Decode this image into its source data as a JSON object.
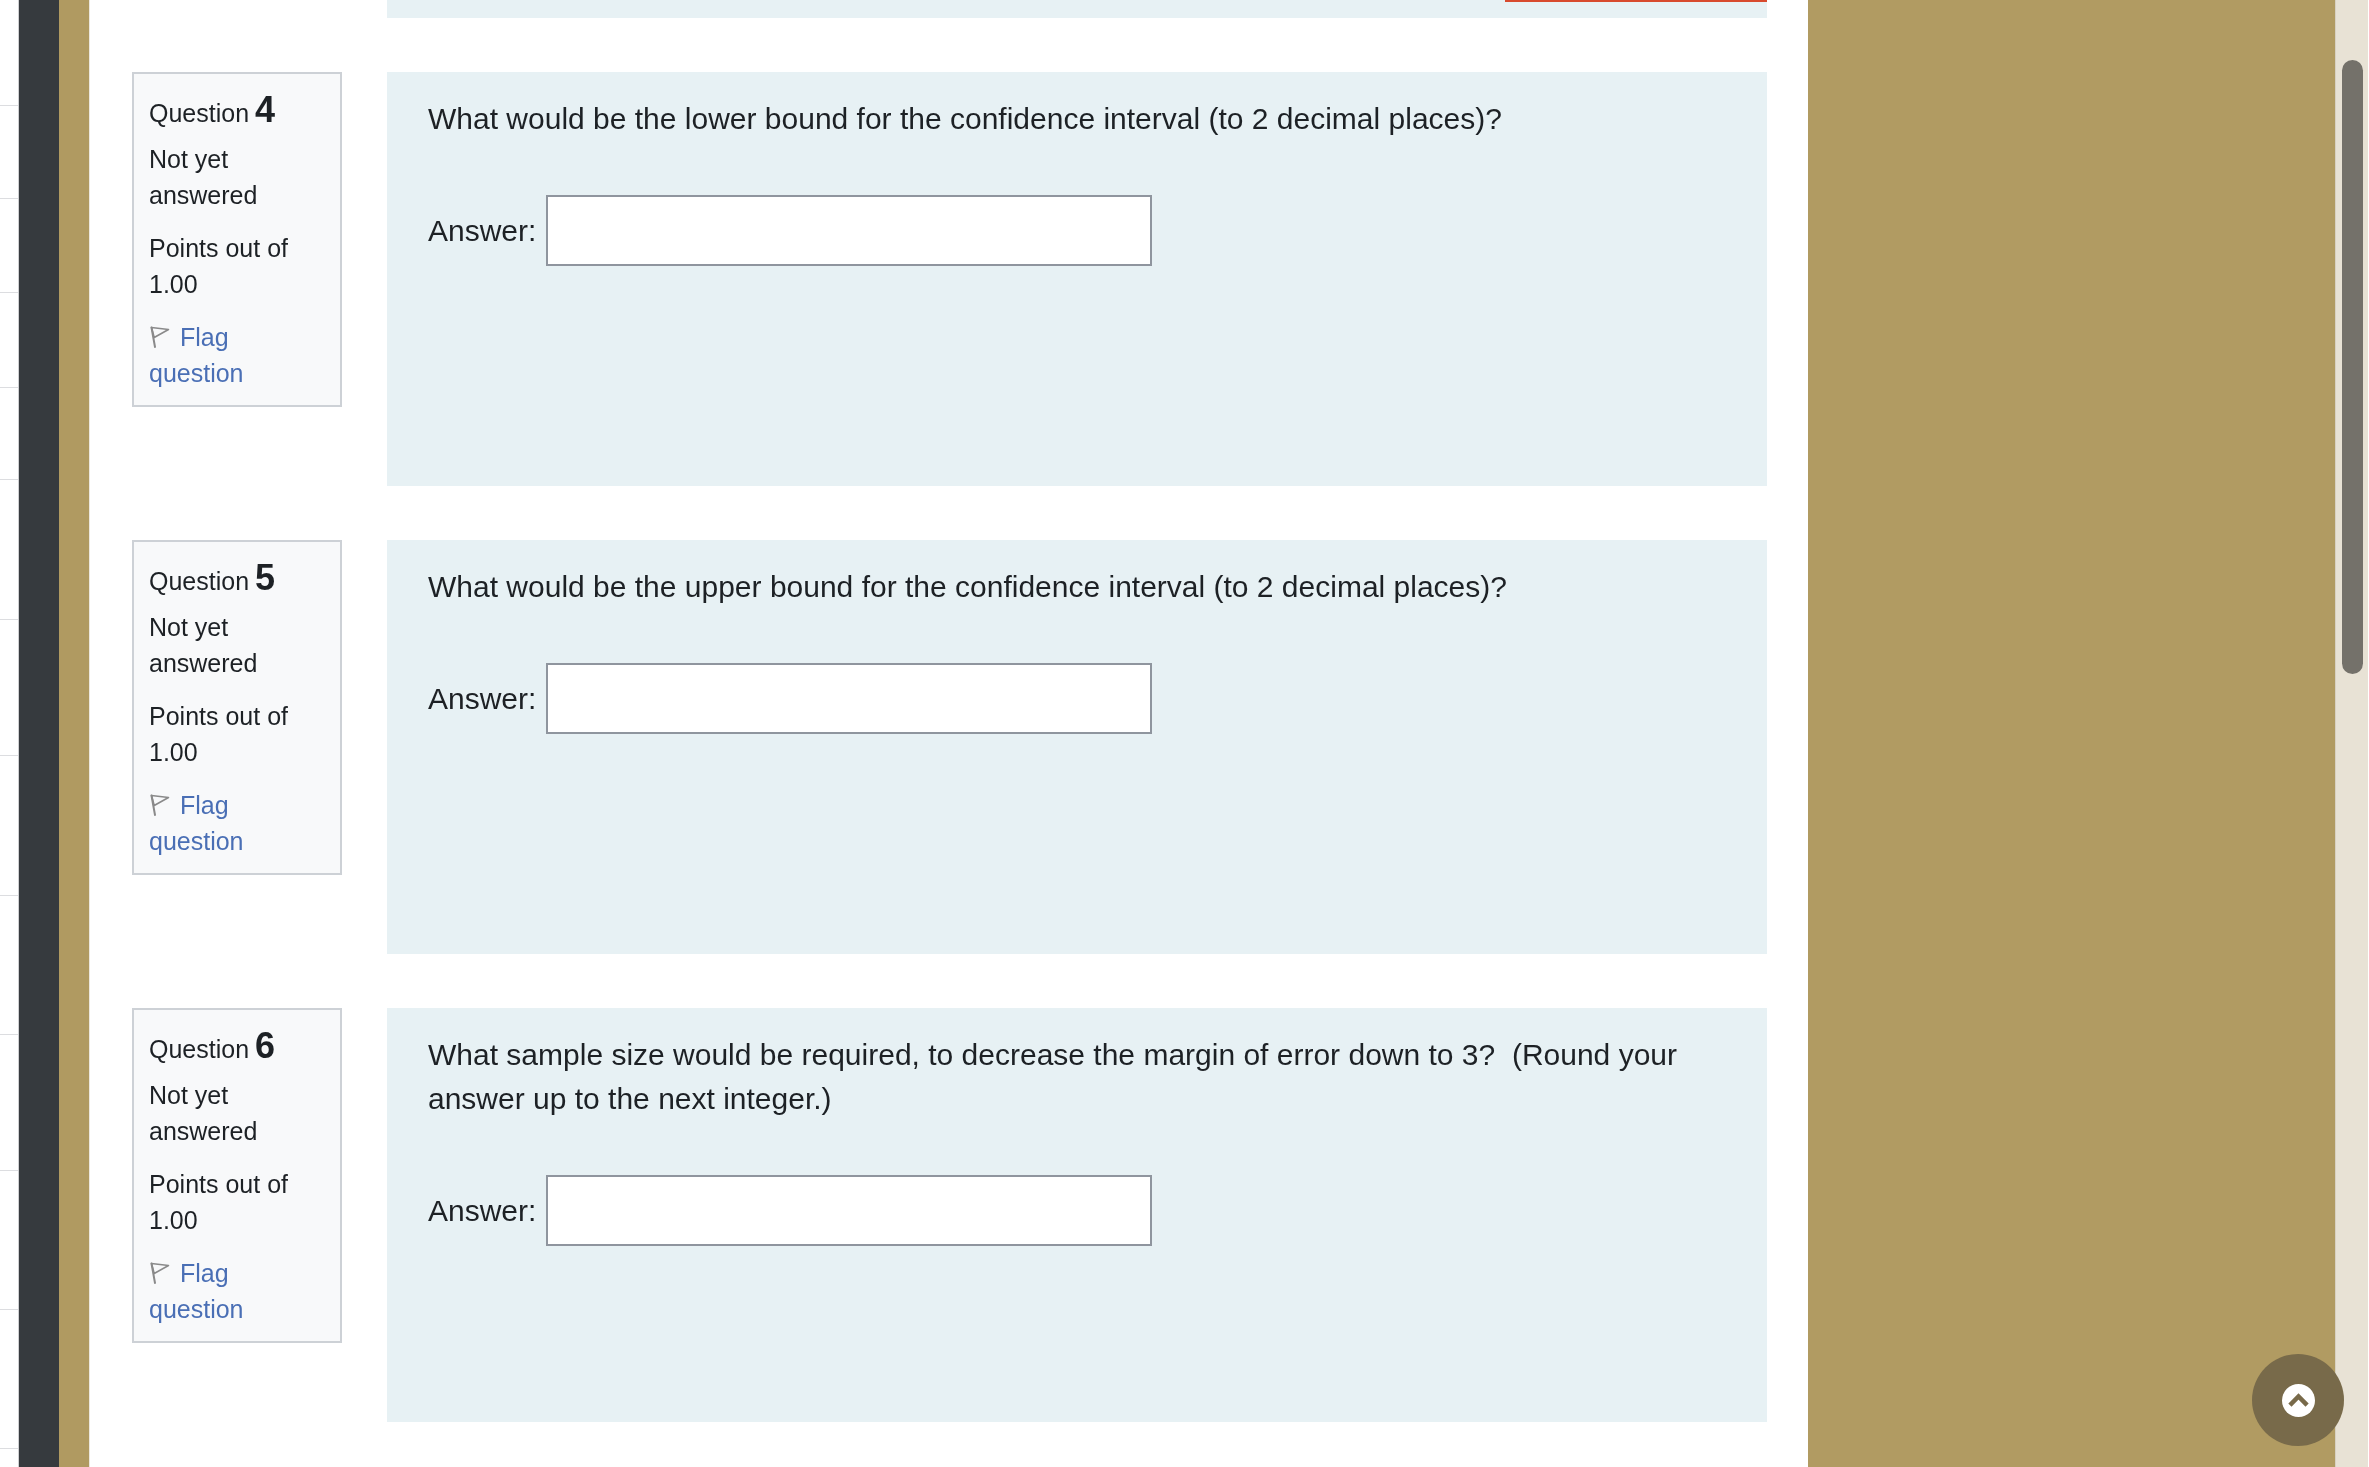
{
  "questions": [
    {
      "label": "Question",
      "number": "4",
      "status": "Not yet answered",
      "points": "Points out of 1.00",
      "flag": {
        "label": "Flag question",
        "flagged": false
      },
      "text": "What would be the lower bound for the confidence interval (to 2 decimal places)?",
      "answer_label": "Answer:"
    },
    {
      "label": "Question",
      "number": "5",
      "status": "Not yet answered",
      "points": "Points out of 1.00",
      "flag": {
        "label": "Flag question",
        "flagged": false
      },
      "text": "What would be the upper bound for the confidence interval (to 2 decimal places)?",
      "answer_label": "Answer:"
    },
    {
      "label": "Question",
      "number": "6",
      "status": "Not yet answered",
      "points": "Points out of 1.00",
      "flag": {
        "label": "Flag question",
        "flagged": false
      },
      "text": "What sample size would be required, to decrease the margin of error down to 3?  (Round your answer up to the next integer.)",
      "answer_label": "Answer:"
    }
  ]
}
